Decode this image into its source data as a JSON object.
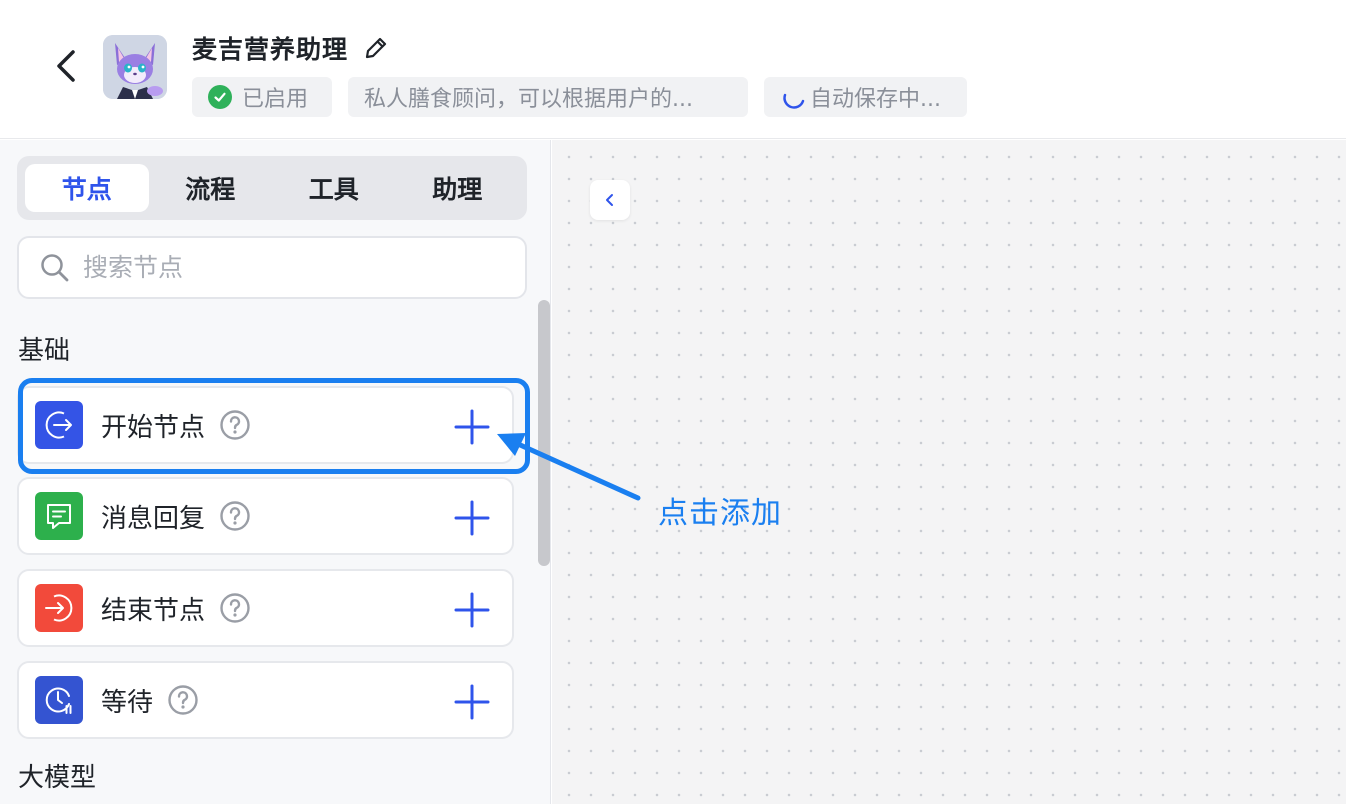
{
  "header": {
    "title": "麦吉营养助理",
    "status_label": "已启用",
    "description": "私人膳食顾问，可以根据用户的...",
    "save_status": "自动保存中..."
  },
  "sidebar": {
    "tabs": [
      {
        "label": "节点",
        "active": true
      },
      {
        "label": "流程",
        "active": false
      },
      {
        "label": "工具",
        "active": false
      },
      {
        "label": "助理",
        "active": false
      }
    ],
    "search_placeholder": "搜索节点",
    "sections": [
      {
        "title": "基础",
        "nodes": [
          {
            "label": "开始节点",
            "icon": "start-node-icon",
            "color": "#3454e6"
          },
          {
            "label": "消息回复",
            "icon": "message-reply-icon",
            "color": "#2db04c"
          },
          {
            "label": "结束节点",
            "icon": "end-node-icon",
            "color": "#f24a3b"
          },
          {
            "label": "等待",
            "icon": "wait-icon",
            "color": "#3454d1"
          }
        ]
      },
      {
        "title": "大模型",
        "nodes": []
      }
    ]
  },
  "annotation": {
    "text": "点击添加",
    "color": "#1a7ff0"
  }
}
